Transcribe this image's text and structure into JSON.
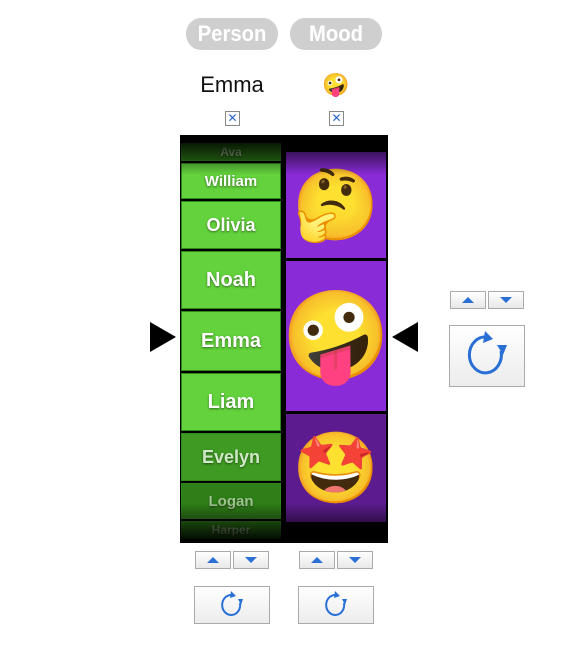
{
  "tabs": [
    {
      "label": "Person"
    },
    {
      "label": "Mood"
    }
  ],
  "selection": {
    "person": "Emma",
    "mood_emoji": "🤪",
    "person_checkbox": "✕",
    "mood_checkbox": "✕"
  },
  "person_reel": [
    "Ava",
    "William",
    "Olivia",
    "Noah",
    "Emma",
    "Liam",
    "Evelyn",
    "Logan",
    "Harper"
  ],
  "mood_reel": [
    "🤔",
    "🤪",
    "🤩"
  ],
  "colors": {
    "name_cell": "#63d23c",
    "emoji_cell": "#8a2bd8",
    "button_arrow": "#2a6fd6"
  },
  "icons": {
    "spin": "refresh-icon",
    "up": "up-arrow-icon",
    "down": "down-arrow-icon"
  }
}
